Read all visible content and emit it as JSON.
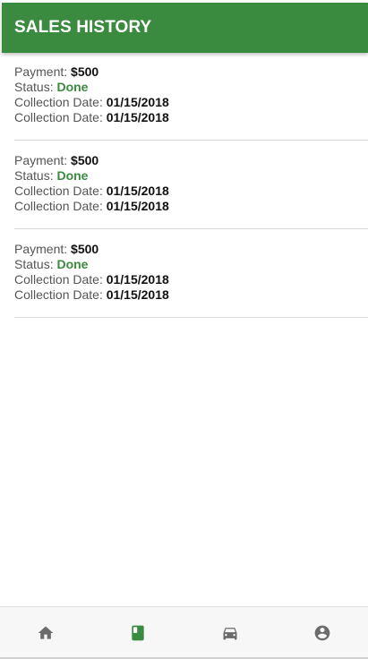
{
  "header": {
    "title": "SALES HISTORY"
  },
  "labels": {
    "payment": "Payment: ",
    "status": "Status: ",
    "collection_date": "Collection Date: "
  },
  "records": [
    {
      "payment": "$500",
      "status": "Done",
      "collection_date_1": "01/15/2018",
      "collection_date_2": "01/15/2018"
    },
    {
      "payment": "$500",
      "status": "Done",
      "collection_date_1": "01/15/2018",
      "collection_date_2": "01/15/2018"
    },
    {
      "payment": "$500",
      "status": "Done",
      "collection_date_1": "01/15/2018",
      "collection_date_2": "01/15/2018"
    }
  ],
  "bottom_nav": {
    "items": [
      {
        "icon": "home-icon",
        "active": false
      },
      {
        "icon": "book-icon",
        "active": true
      },
      {
        "icon": "car-icon",
        "active": false
      },
      {
        "icon": "account-icon",
        "active": false
      }
    ]
  },
  "colors": {
    "primary": "#3a8a3f",
    "status_done": "#3a8a3f",
    "nav_inactive": "#6b6b6b",
    "nav_active": "#3a8a3f"
  }
}
